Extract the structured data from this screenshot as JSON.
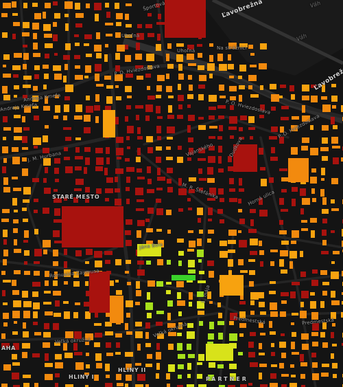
{
  "map": {
    "colors": {
      "background": "#141414",
      "street": "#252525",
      "rail": "#2f2f2f",
      "river": "#1a1a1a",
      "cat_red": "#a8120e",
      "cat_orange": "#f28a0e",
      "cat_amber": "#f7a20f",
      "cat_yellow": "#d8e21a",
      "cat_lime": "#a6e01b",
      "cat_green": "#3ad12a"
    },
    "labels": [
      {
        "id": "lavobrezna-1",
        "text": "Ľavobrežná"
      },
      {
        "id": "lavobrezna-2",
        "text": "Ľavobrežná"
      },
      {
        "id": "vah",
        "text": "Váh"
      },
      {
        "id": "vah-2",
        "text": "Váh"
      },
      {
        "id": "sportova",
        "text": "Športová"
      },
      {
        "id": "uholna-1",
        "text": "Uhoľná"
      },
      {
        "id": "uholna-2",
        "text": "Uhoľná"
      },
      {
        "id": "na-strzinci",
        "text": "Na strážnici"
      },
      {
        "id": "po-hviezdoslava-1",
        "text": "P. O. Hviezdoslava"
      },
      {
        "id": "po-hviezdoslava-2",
        "text": "P. O. Hviezdoslava"
      },
      {
        "id": "po-hviezdoslava-3",
        "text": "P. O. Hviezdoslava"
      },
      {
        "id": "andreja-kmeta-1",
        "text": "Andreja Kmeťa"
      },
      {
        "id": "andreja-kmeta-2",
        "text": "Andreja Kmeťa"
      },
      {
        "id": "j-m-hurbana",
        "text": "J. M. Hurbana"
      },
      {
        "id": "vajanskeho",
        "text": "Vajanského"
      },
      {
        "id": "dudkova",
        "text": "Dudkova"
      },
      {
        "id": "m-r-stefanika",
        "text": "M. R. Štefánika"
      },
      {
        "id": "horna-ulica",
        "text": "Horná ulica"
      },
      {
        "id": "stare-mesto",
        "text": "STARÉ MESTO"
      },
      {
        "id": "jana-bola",
        "text": "Jána Bola"
      },
      {
        "id": "romualda-zaymusa",
        "text": "Romualda Zaymusa"
      },
      {
        "id": "predmestska-1",
        "text": "Predmestská"
      },
      {
        "id": "predmestska-2",
        "text": "Predmestská"
      },
      {
        "id": "velka-okruzna-1",
        "text": "Veľká okružná"
      },
      {
        "id": "velka-okruzna-2",
        "text": "Veľká okružná"
      },
      {
        "id": "1-maja",
        "text": "1. mája"
      },
      {
        "id": "hliny-i",
        "text": "HLINY I"
      },
      {
        "id": "hliny-ii",
        "text": "HLINY II"
      },
      {
        "id": "aha",
        "text": "AHA"
      },
      {
        "id": "partner",
        "text": "PARTNER"
      }
    ]
  }
}
